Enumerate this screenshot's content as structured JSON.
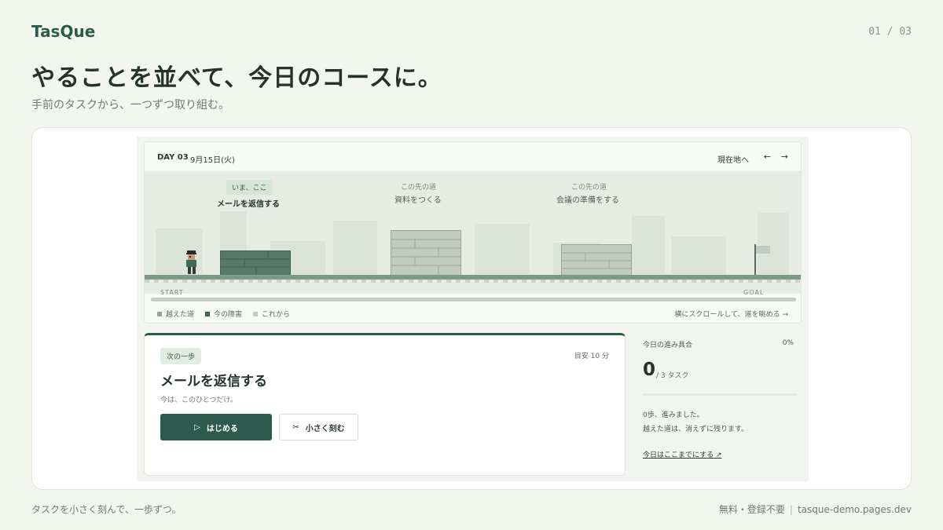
{
  "brand": "TasQue",
  "pager": "01 / 03",
  "headline": "やることを並べて、今日のコースに。",
  "subhead": "手前のタスクから、一つずつ取り組む。",
  "app": {
    "day": "DAY 03",
    "date": "9月15日(火)",
    "here_link": "現在地へ",
    "prev_icon": "←",
    "next_icon": "→",
    "course": [
      {
        "tag": "いま、ここ",
        "title": "メールを返信する",
        "state": "current"
      },
      {
        "tag": "この先の道",
        "title": "資料をつくる",
        "state": "future"
      },
      {
        "tag": "この先の道",
        "title": "会議の準備をする",
        "state": "future"
      }
    ],
    "start_label": "START",
    "goal_label": "GOAL",
    "legend": [
      {
        "label": "越えた道",
        "color": "#9aa69c"
      },
      {
        "label": "今の障害",
        "color": "#3e6354"
      },
      {
        "label": "これから",
        "color": "#c2cbc1"
      }
    ],
    "scroll_hint": "横にスクロールして、道を眺める →",
    "task": {
      "chip": "次の一歩",
      "estimate": "目安 10 分",
      "title": "メールを返信する",
      "subtitle": "今は、このひとつだけ。",
      "start_icon": "▷",
      "start_button": "はじめる",
      "split_icon": "✂",
      "split_button": "小さく刻む"
    },
    "progress": {
      "label": "今日の進み具合",
      "percent": "0%",
      "fill": 0,
      "count": "0",
      "of": "/ 3 タスク",
      "message1": "0歩、進みました。",
      "message2": "越えた道は、消えずに残ります。",
      "stop_link": "今日はここまでにする ↗"
    }
  },
  "footer": {
    "left": "タスクを小さく刻んで、一歩ずつ。",
    "price": "無料・登録不要",
    "sep": "|",
    "url": "tasque-demo.pages.dev"
  }
}
